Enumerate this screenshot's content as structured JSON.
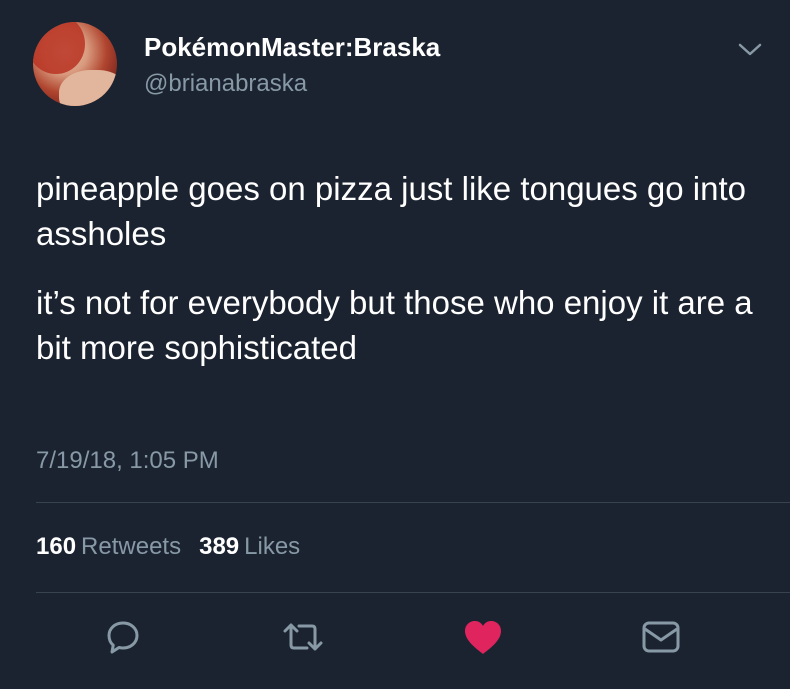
{
  "user": {
    "display_name": "PokémonMaster:Braska",
    "handle": "@brianabraska"
  },
  "tweet": {
    "paragraphs": [
      "pineapple goes on pizza just like tongues go into assholes",
      "it’s not for everybody but those who enjoy it are a bit more sophisticated"
    ],
    "timestamp": "7/19/18, 1:05 PM"
  },
  "stats": {
    "retweets_count": "160",
    "retweets_label": "Retweets",
    "likes_count": "389",
    "likes_label": "Likes"
  },
  "actions": [
    {
      "icon": "reply-icon"
    },
    {
      "icon": "retweet-icon"
    },
    {
      "icon": "heart-icon",
      "liked": true
    },
    {
      "icon": "message-icon"
    }
  ],
  "colors": {
    "background": "#1b2330",
    "text": "#ffffff",
    "secondary": "#8899a6",
    "like": "#e0245e",
    "divider": "#38444d"
  }
}
